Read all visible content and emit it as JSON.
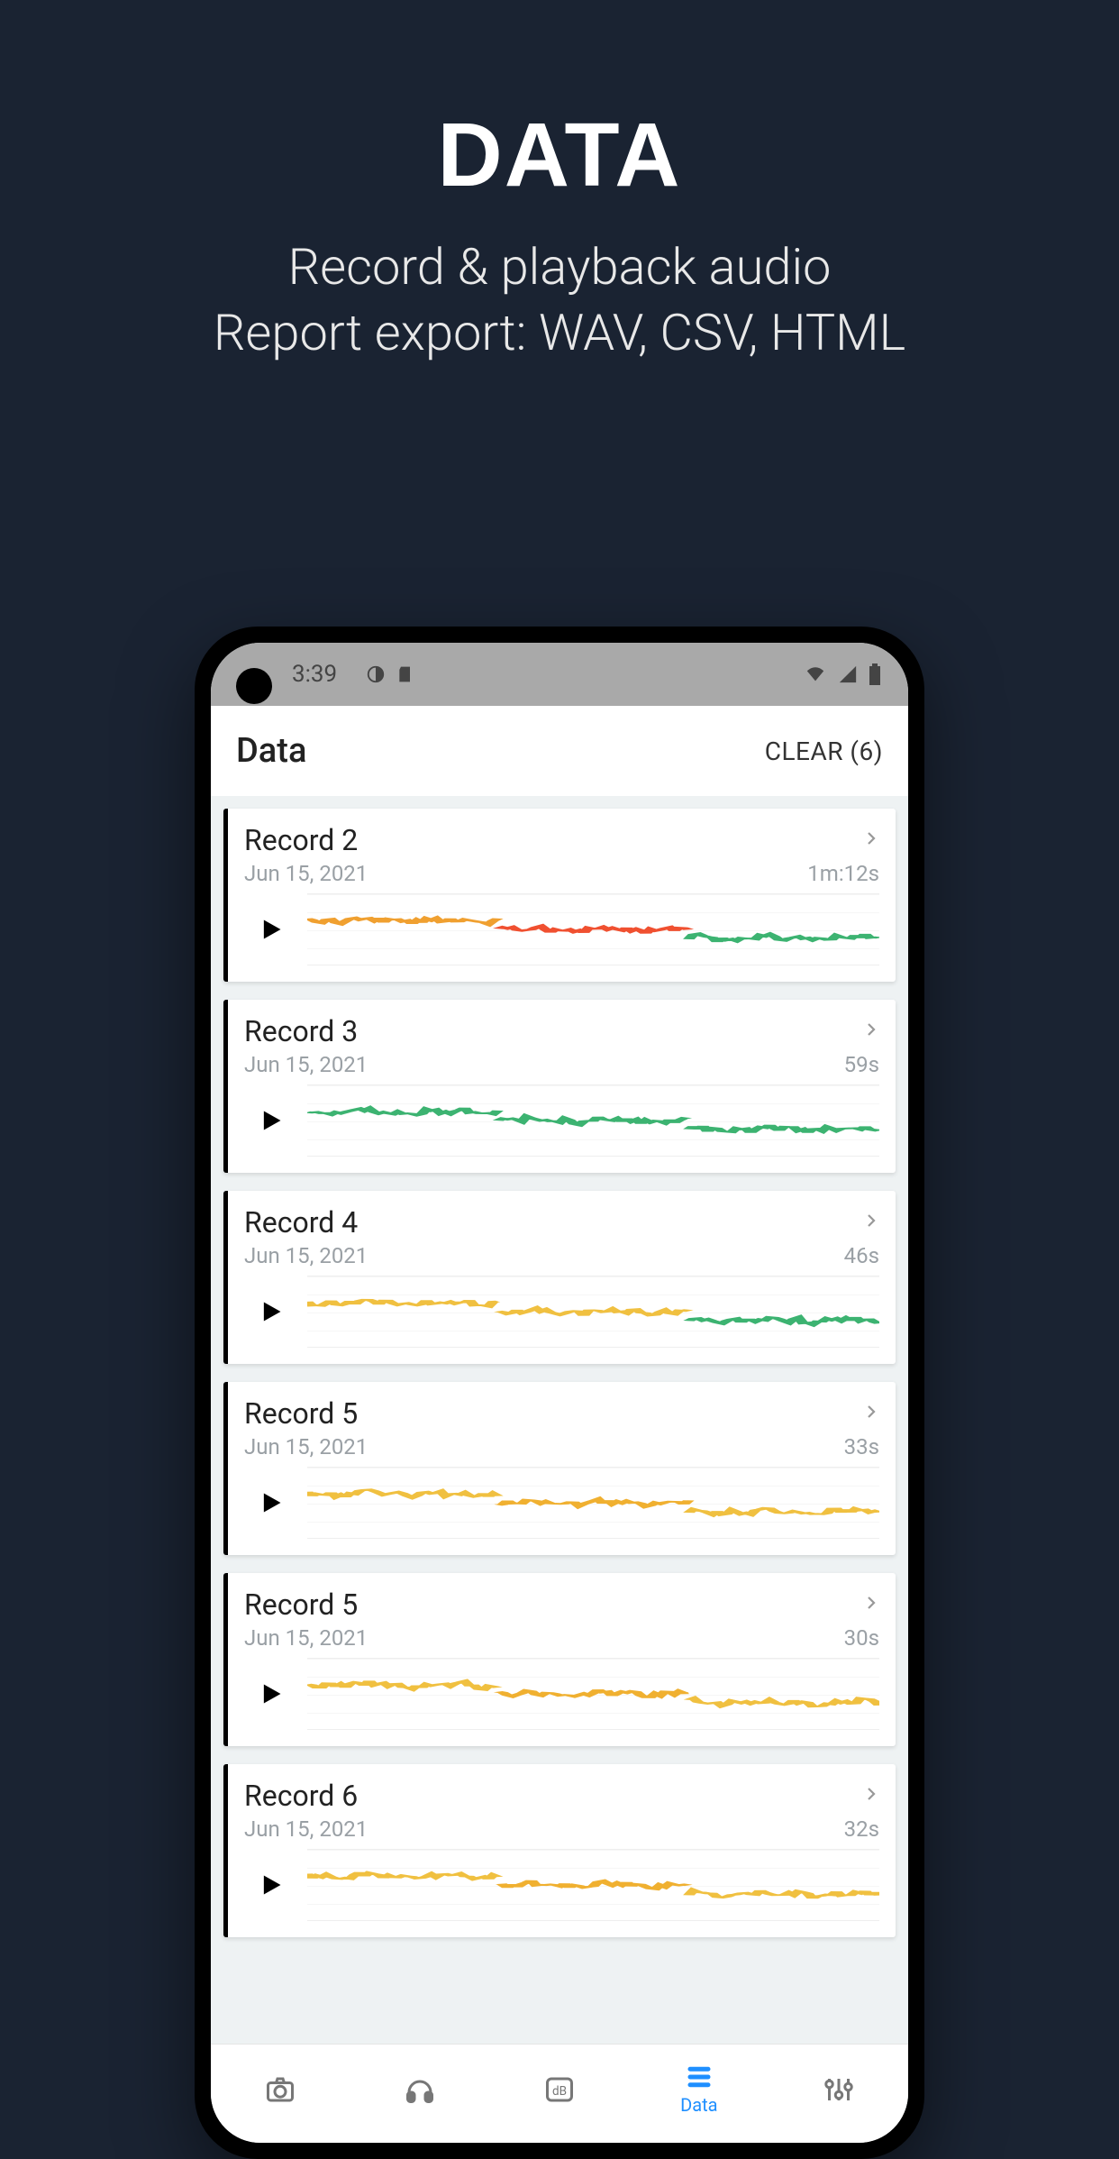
{
  "promo": {
    "title": "DATA",
    "sub1": "Record & playback audio",
    "sub2": "Report export: WAV, CSV, HTML"
  },
  "statusbar": {
    "time": "3:39",
    "icons": [
      "contrast-icon",
      "sd-icon",
      "wifi-icon",
      "signal-icon",
      "battery-icon"
    ]
  },
  "appbar": {
    "title": "Data",
    "clear_label": "CLEAR (6)"
  },
  "records": [
    {
      "name": "Record 2",
      "date": "Jun 15, 2021",
      "duration": "1m:12s",
      "colors": [
        "#f0a030",
        "#f05030",
        "#3cb371"
      ]
    },
    {
      "name": "Record 3",
      "date": "Jun 15, 2021",
      "duration": "59s",
      "colors": [
        "#3cb371",
        "#3cb371",
        "#3cb371"
      ]
    },
    {
      "name": "Record 4",
      "date": "Jun 15, 2021",
      "duration": "46s",
      "colors": [
        "#f0c040",
        "#f0c040",
        "#3cb371"
      ]
    },
    {
      "name": "Record 5",
      "date": "Jun 15, 2021",
      "duration": "33s",
      "colors": [
        "#f0c040",
        "#f0b030",
        "#f0c040"
      ]
    },
    {
      "name": "Record 5",
      "date": "Jun 15, 2021",
      "duration": "30s",
      "colors": [
        "#f0c040",
        "#f0b030",
        "#f0c040"
      ]
    },
    {
      "name": "Record 6",
      "date": "Jun 15, 2021",
      "duration": "32s",
      "colors": [
        "#f0c040",
        "#f0b030",
        "#f0c040"
      ]
    }
  ],
  "bottomnav": {
    "items": [
      {
        "icon": "camera-icon",
        "label": ""
      },
      {
        "icon": "headphones-icon",
        "label": ""
      },
      {
        "icon": "db-meter-icon",
        "label": ""
      },
      {
        "icon": "list-icon",
        "label": "Data",
        "active": true
      },
      {
        "icon": "sliders-icon",
        "label": ""
      }
    ]
  }
}
